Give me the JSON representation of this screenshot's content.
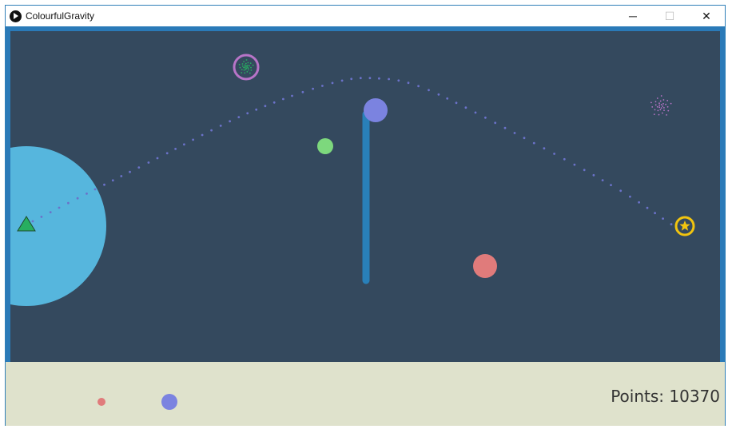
{
  "window": {
    "title": "ColourfulGravity",
    "controls": {
      "minimize": "─",
      "maximize": "☐",
      "close": "✕"
    }
  },
  "game": {
    "colors": {
      "background": "#34495e",
      "frame": "#2a7ab8",
      "planet": "#56b6dd",
      "player": "#27ae60",
      "trajectory": "#6b72c9",
      "barrier": "#2980b9",
      "goal": "#f1c40f",
      "portal": "#b774c7",
      "orb_blue": "#7b83e0",
      "orb_green": "#7dd87d",
      "orb_red": "#e07b7b"
    },
    "icons": {
      "player": "triangle-icon",
      "goal": "star-icon",
      "portal": "spiral-icon",
      "portal_small": "spiral-icon"
    }
  },
  "hud": {
    "points_label": "Points: 10370",
    "points_value": 10370,
    "inventory": [
      {
        "color": "#e07b7b",
        "size": "small"
      },
      {
        "color": "#7b83e0",
        "size": "medium"
      }
    ]
  }
}
